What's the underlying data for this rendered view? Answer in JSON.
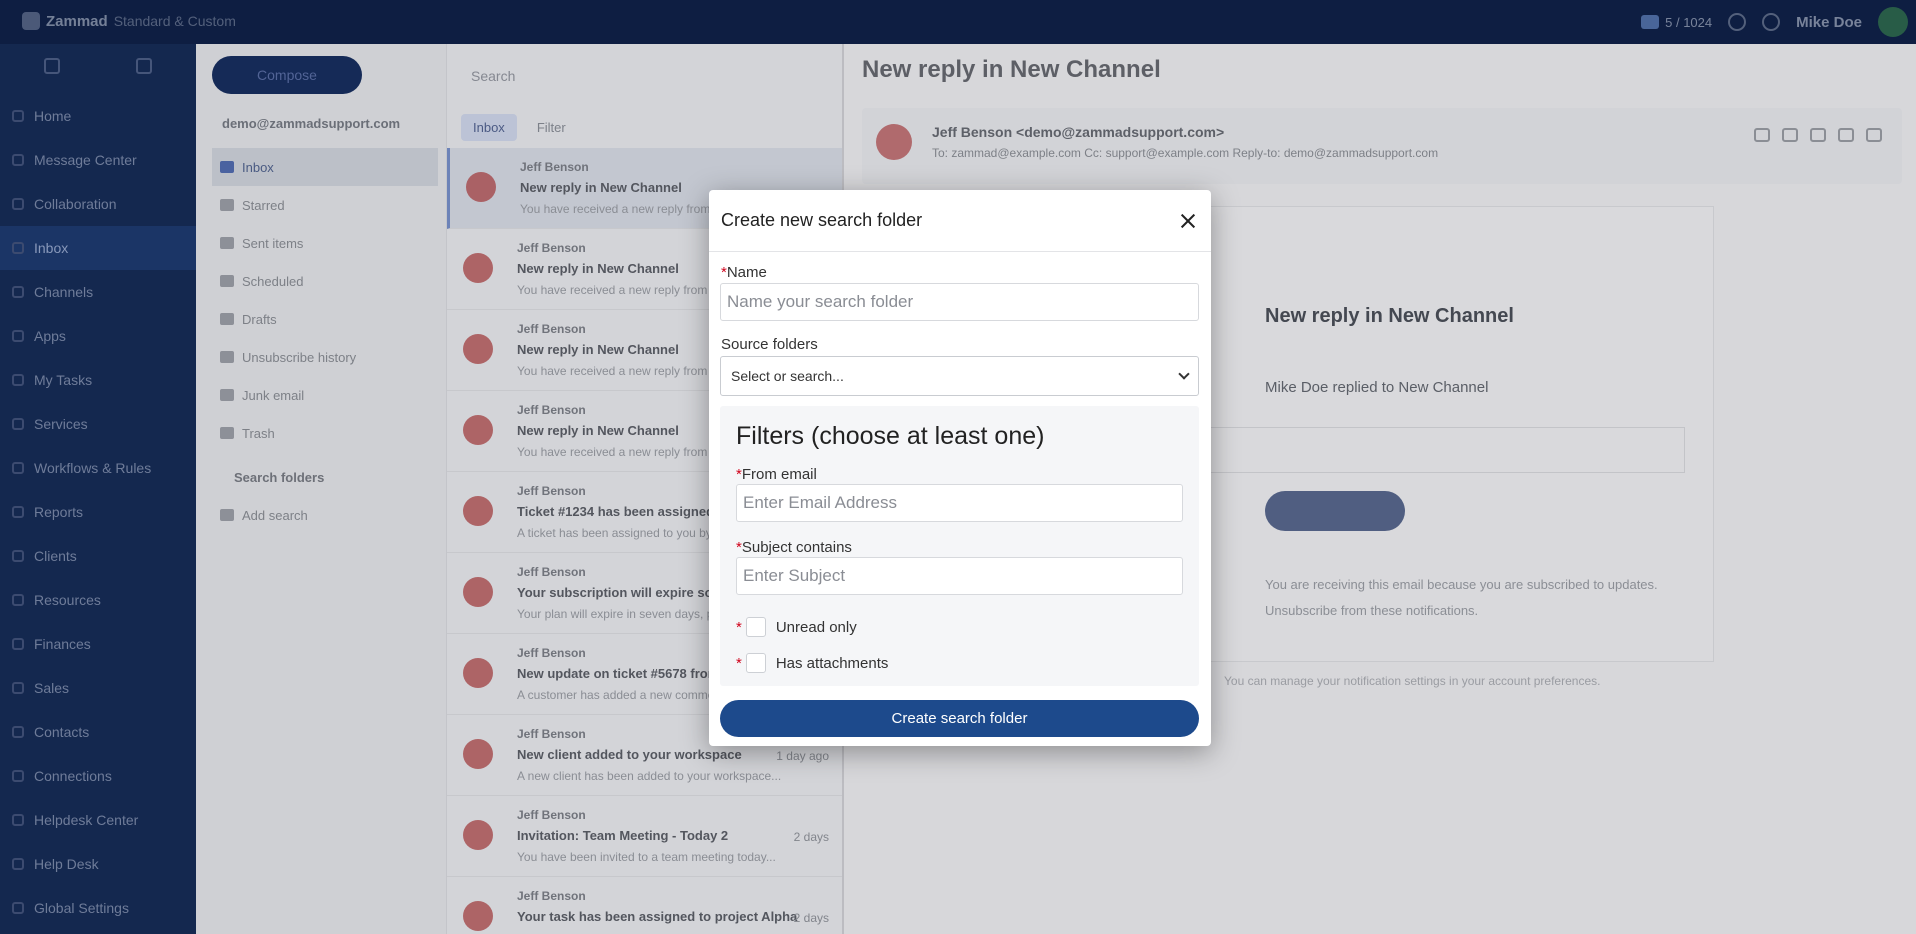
{
  "topbar": {
    "logo_text": "Zammad",
    "logo_sub": "Standard & Custom",
    "status_label": "5 / 1024",
    "user_label": "Mike Doe"
  },
  "leftnav": {
    "items": [
      {
        "label": "Home"
      },
      {
        "label": "Message Center"
      },
      {
        "label": "Collaboration"
      },
      {
        "label": "Inbox"
      },
      {
        "label": "Channels"
      },
      {
        "label": "Apps"
      },
      {
        "label": "My Tasks"
      },
      {
        "label": "Services"
      },
      {
        "label": "Workflows & Rules"
      },
      {
        "label": "Reports"
      },
      {
        "label": "Clients"
      },
      {
        "label": "Resources"
      },
      {
        "label": "Finances"
      },
      {
        "label": "Sales"
      },
      {
        "label": "Contacts"
      },
      {
        "label": "Connections"
      },
      {
        "label": "Helpdesk Center"
      },
      {
        "label": "Help Desk"
      },
      {
        "label": "Global Settings"
      }
    ]
  },
  "folders": {
    "compose_label": "Compose",
    "account": "demo@zammadsupport.com",
    "items": [
      {
        "label": "Inbox"
      },
      {
        "label": "Starred"
      },
      {
        "label": "Sent items"
      },
      {
        "label": "Scheduled"
      },
      {
        "label": "Drafts"
      },
      {
        "label": "Unsubscribe history"
      },
      {
        "label": "Junk email"
      },
      {
        "label": "Trash"
      }
    ],
    "search_header": "Search folders",
    "search_items": [
      {
        "label": "Add search"
      }
    ]
  },
  "msglist": {
    "search_placeholder": "Search",
    "tabs": [
      {
        "label": "Inbox"
      },
      {
        "label": "Filter"
      }
    ],
    "rows": [
      {
        "from": "Jeff Benson",
        "subject": "New reply in New Channel",
        "preview": "You have received a new reply from a customer in...",
        "time": ""
      },
      {
        "from": "Jeff Benson",
        "subject": "New reply in New Channel",
        "preview": "You have received a new reply from a customer in...",
        "time": ""
      },
      {
        "from": "Jeff Benson",
        "subject": "New reply in New Channel",
        "preview": "You have received a new reply from a customer in...",
        "time": ""
      },
      {
        "from": "Jeff Benson",
        "subject": "New reply in New Channel",
        "preview": "You have received a new reply from a customer in...",
        "time": ""
      },
      {
        "from": "Jeff Benson",
        "subject": "Ticket #1234 has been assigned to you",
        "preview": "A ticket has been assigned to you by the system...",
        "time": ""
      },
      {
        "from": "Jeff Benson",
        "subject": "Your subscription will expire soon",
        "preview": "Your plan will expire in seven days, please renew...",
        "time": ""
      },
      {
        "from": "Jeff Benson",
        "subject": "New update on ticket #5678 from customer",
        "preview": "A customer has added a new comment on the ticket...",
        "time": ""
      },
      {
        "from": "Jeff Benson",
        "subject": "New client added to your workspace",
        "preview": "A new client has been added to your workspace...",
        "time": "1 day ago"
      },
      {
        "from": "Jeff Benson",
        "subject": "Invitation: Team Meeting - Today 2",
        "preview": "You have been invited to a team meeting today...",
        "time": "2 days"
      },
      {
        "from": "Jeff Benson",
        "subject": "Your task has been assigned to project Alpha",
        "preview": "",
        "time": "2 days"
      }
    ]
  },
  "reader": {
    "title": "New reply in New Channel",
    "from": "Jeff Benson <demo@zammadsupport.com>",
    "to": "To: zammad@example.com  Cc: support@example.com  Reply-to: demo@zammadsupport.com",
    "card_heading": "New reply in New Channel",
    "card_line": "Mike Doe replied to New Channel",
    "card_text1": "You are receiving this email because you are subscribed to updates.",
    "card_text2": "Unsubscribe from these notifications.",
    "footer": "You can manage your notification settings in your account preferences."
  },
  "modal": {
    "title": "Create new search folder",
    "name_label": "Name",
    "name_placeholder": "Name your search folder",
    "source_label": "Source folders",
    "source_value": "Select or search...",
    "filters_heading": "Filters (choose at least one)",
    "from_label": "From email",
    "from_placeholder": "Enter Email Address",
    "subject_label": "Subject contains",
    "subject_placeholder": "Enter Subject",
    "unread_label": "Unread only",
    "attach_label": "Has attachments",
    "required_mark": "*",
    "submit_label": "Create search folder"
  },
  "colors": {
    "nav_bg": "#14284f",
    "accent": "#1d4a8c",
    "required": "#d0021b"
  }
}
